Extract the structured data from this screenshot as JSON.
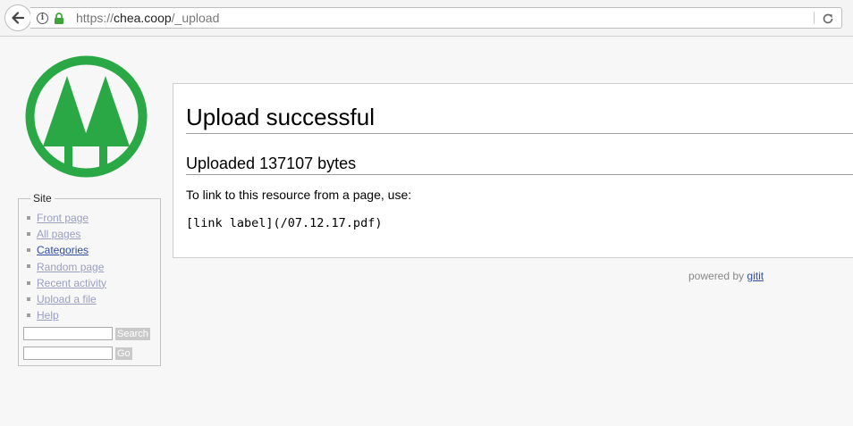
{
  "browser": {
    "url_scheme": "https://",
    "url_host": "chea.coop",
    "url_path": "/_upload"
  },
  "sidebar": {
    "section_title": "Site",
    "items": [
      {
        "label": "Front page"
      },
      {
        "label": "All pages"
      },
      {
        "label": "Categories"
      },
      {
        "label": "Random page"
      },
      {
        "label": "Recent activity"
      },
      {
        "label": "Upload a file"
      },
      {
        "label": "Help"
      }
    ],
    "search_button": "Search",
    "go_button": "Go"
  },
  "content": {
    "title": "Upload successful",
    "subtitle": "Uploaded 137107 bytes",
    "instruction": "To link to this resource from a page, use:",
    "link_code": "[link label](/07.12.17.pdf)"
  },
  "footer": {
    "prefix": "powered by",
    "link": "gitit"
  },
  "colors": {
    "logo_green": "#2aa845",
    "link_visited": "#2f4ea0",
    "link": "#9a9fc0"
  },
  "icons": [
    "back-arrow-icon",
    "info-icon",
    "lock-icon",
    "reload-icon",
    "tree-logo"
  ]
}
